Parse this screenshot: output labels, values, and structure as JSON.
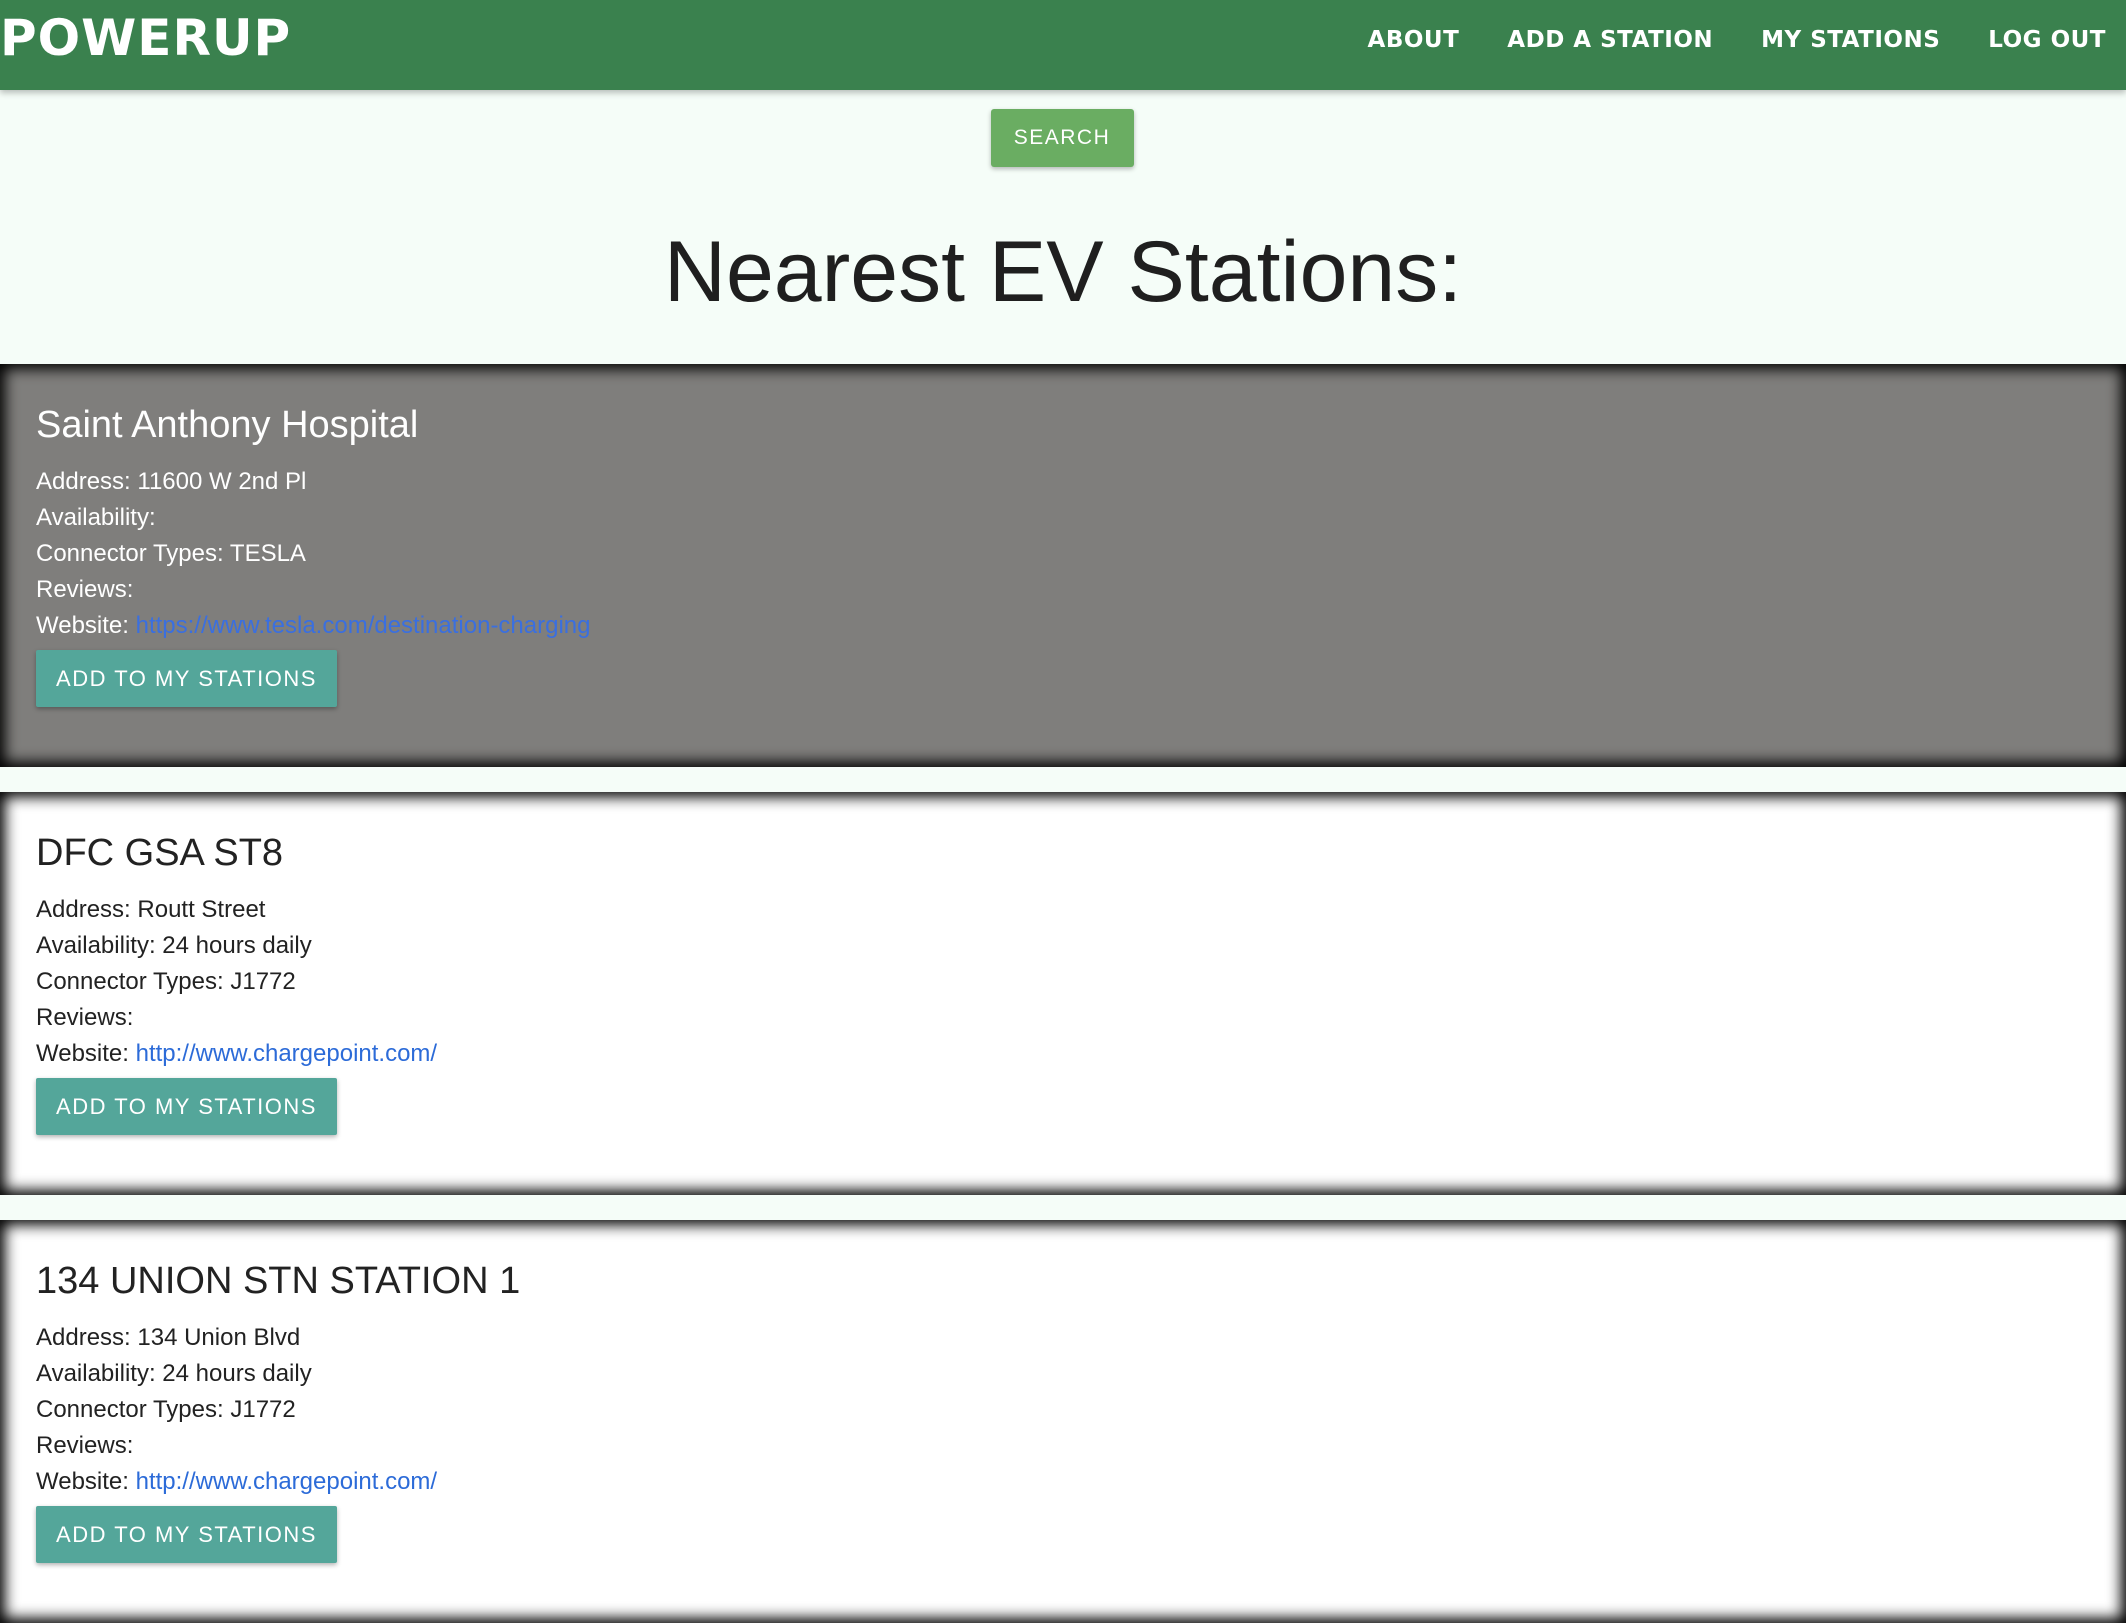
{
  "navbar": {
    "brand": "POWERUP",
    "links": [
      {
        "label": "ABOUT"
      },
      {
        "label": "ADD A STATION"
      },
      {
        "label": "MY STATIONS"
      },
      {
        "label": "LOG OUT"
      }
    ],
    "background": "#3a814e"
  },
  "search": {
    "label": "SEARCH"
  },
  "page_title": "Nearest EV Stations:",
  "field_labels": {
    "address": "Address:",
    "availability": "Availability:",
    "connector_types": "Connector Types:",
    "reviews": "Reviews:",
    "website": "Website:"
  },
  "stations": [
    {
      "name": "Saint Anthony Hospital",
      "address": "11600 W 2nd Pl",
      "availability": "",
      "connector_types": "TESLA",
      "reviews": "",
      "website": "https://www.tesla.com/destination-charging",
      "button_label": "ADD TO MY STATIONS",
      "highlighted": true
    },
    {
      "name": "DFC GSA ST8",
      "address": "Routt Street",
      "availability": "24 hours daily",
      "connector_types": "J1772",
      "reviews": "",
      "website": "http://www.chargepoint.com/",
      "button_label": "ADD TO MY STATIONS",
      "highlighted": false
    },
    {
      "name": "134 UNION STN STATION 1",
      "address": "134 Union Blvd",
      "availability": "24 hours daily",
      "connector_types": "J1772",
      "reviews": "",
      "website": "http://www.chargepoint.com/",
      "button_label": "ADD TO MY STATIONS",
      "highlighted": false
    }
  ],
  "colors": {
    "page_background": "#f5fdf8",
    "search_button": "#6aad62",
    "add_button": "#54a69a",
    "highlight_card": "#7f7e7c",
    "link": "#2c6bd8"
  }
}
